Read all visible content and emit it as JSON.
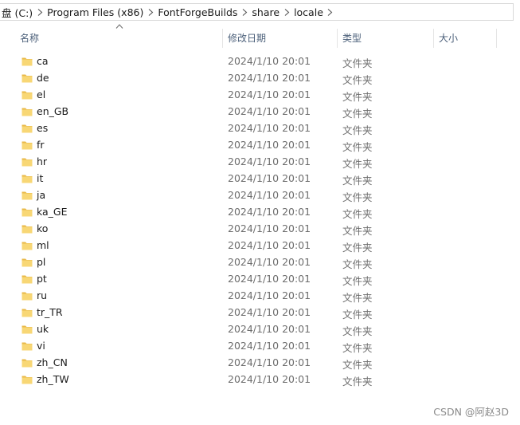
{
  "breadcrumb": [
    {
      "label": "盘 (C:)"
    },
    {
      "label": "Program Files (x86)"
    },
    {
      "label": "FontForgeBuilds"
    },
    {
      "label": "share"
    },
    {
      "label": "locale"
    }
  ],
  "columns": {
    "name": "名称",
    "date": "修改日期",
    "type": "类型",
    "size": "大小"
  },
  "files": [
    {
      "name": "ca",
      "date": "2024/1/10 20:01",
      "type": "文件夹"
    },
    {
      "name": "de",
      "date": "2024/1/10 20:01",
      "type": "文件夹"
    },
    {
      "name": "el",
      "date": "2024/1/10 20:01",
      "type": "文件夹"
    },
    {
      "name": "en_GB",
      "date": "2024/1/10 20:01",
      "type": "文件夹"
    },
    {
      "name": "es",
      "date": "2024/1/10 20:01",
      "type": "文件夹"
    },
    {
      "name": "fr",
      "date": "2024/1/10 20:01",
      "type": "文件夹"
    },
    {
      "name": "hr",
      "date": "2024/1/10 20:01",
      "type": "文件夹"
    },
    {
      "name": "it",
      "date": "2024/1/10 20:01",
      "type": "文件夹"
    },
    {
      "name": "ja",
      "date": "2024/1/10 20:01",
      "type": "文件夹"
    },
    {
      "name": "ka_GE",
      "date": "2024/1/10 20:01",
      "type": "文件夹"
    },
    {
      "name": "ko",
      "date": "2024/1/10 20:01",
      "type": "文件夹"
    },
    {
      "name": "ml",
      "date": "2024/1/10 20:01",
      "type": "文件夹"
    },
    {
      "name": "pl",
      "date": "2024/1/10 20:01",
      "type": "文件夹"
    },
    {
      "name": "pt",
      "date": "2024/1/10 20:01",
      "type": "文件夹"
    },
    {
      "name": "ru",
      "date": "2024/1/10 20:01",
      "type": "文件夹"
    },
    {
      "name": "tr_TR",
      "date": "2024/1/10 20:01",
      "type": "文件夹"
    },
    {
      "name": "uk",
      "date": "2024/1/10 20:01",
      "type": "文件夹"
    },
    {
      "name": "vi",
      "date": "2024/1/10 20:01",
      "type": "文件夹"
    },
    {
      "name": "zh_CN",
      "date": "2024/1/10 20:01",
      "type": "文件夹"
    },
    {
      "name": "zh_TW",
      "date": "2024/1/10 20:01",
      "type": "文件夹"
    }
  ],
  "watermark": "CSDN @阿赵3D",
  "colors": {
    "folder_body": "#f8d775",
    "folder_tab": "#e9b949",
    "header_text": "#4c607a"
  }
}
